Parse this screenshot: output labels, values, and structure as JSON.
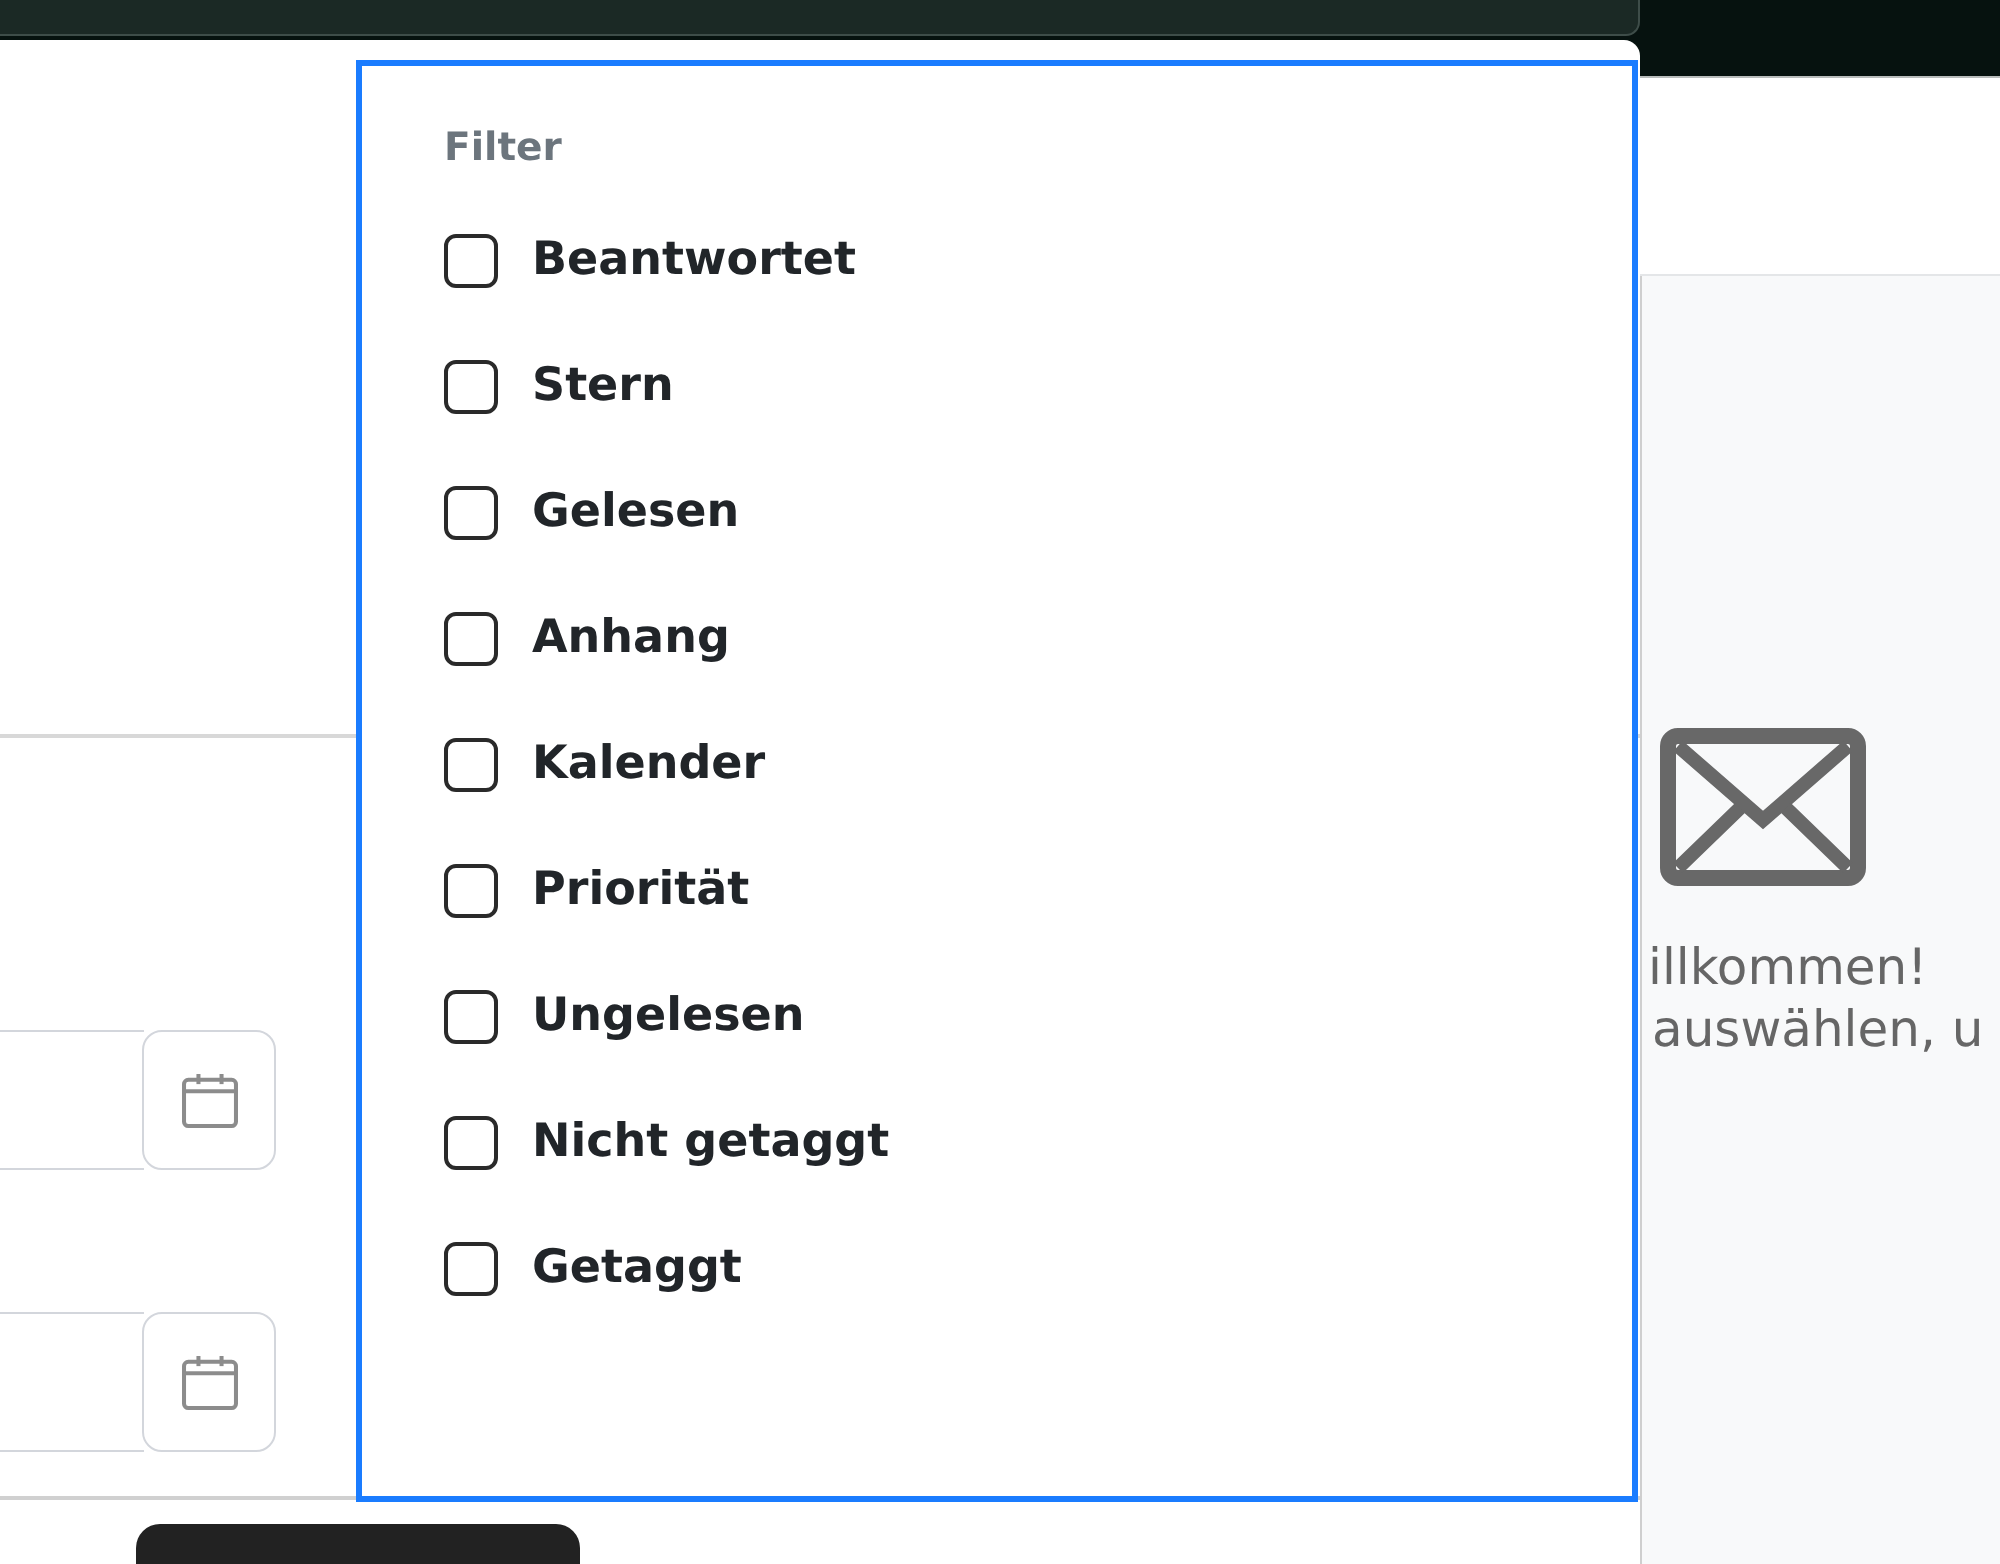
{
  "filter_menu": {
    "title": "Filter",
    "options": [
      {
        "label": "Beantwortet",
        "checked": false
      },
      {
        "label": "Stern",
        "checked": false
      },
      {
        "label": "Gelesen",
        "checked": false
      },
      {
        "label": "Anhang",
        "checked": false
      },
      {
        "label": "Kalender",
        "checked": false
      },
      {
        "label": "Priorität",
        "checked": false
      },
      {
        "label": "Ungelesen",
        "checked": false
      },
      {
        "label": "Nicht getaggt",
        "checked": false
      },
      {
        "label": "Getaggt",
        "checked": false
      }
    ]
  },
  "welcome": {
    "heading": "illkommen!",
    "message": "auswählen, u"
  }
}
